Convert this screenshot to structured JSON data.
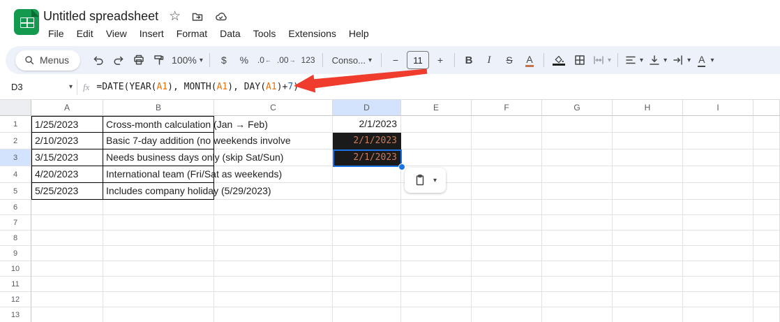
{
  "app": {
    "title": "Untitled spreadsheet",
    "menu_items": [
      "File",
      "Edit",
      "View",
      "Insert",
      "Format",
      "Data",
      "Tools",
      "Extensions",
      "Help"
    ]
  },
  "icons": {
    "star": "☆",
    "caret_down": "▾"
  },
  "toolbar": {
    "menus_label": "Menus",
    "zoom_level": "100%",
    "currency_label": "$",
    "percent_label": "%",
    "decrease_decimals_label": ".0",
    "decrease_decimals_arrow": "←",
    "increase_decimals_label": ".00",
    "increase_decimals_arrow": "→",
    "more_formats_label": "123",
    "font_name": "Conso...",
    "minus_label": "−",
    "font_size": "11",
    "plus_label": "+",
    "bold_label": "B",
    "italic_label": "I",
    "strikethrough_label": "S",
    "text_color_label": "A",
    "text_rotation_label": "A"
  },
  "formula_bar": {
    "cell_reference": "D3",
    "fx_label": "fx",
    "formula_full": "=DATE(YEAR(A1), MONTH(A1), DAY(A1)+7)",
    "formula_parts": [
      {
        "text": "=DATE(YEAR(",
        "type": "plain"
      },
      {
        "text": "A1",
        "type": "ref"
      },
      {
        "text": "), MONTH(",
        "type": "plain"
      },
      {
        "text": "A1",
        "type": "ref"
      },
      {
        "text": "), DAY(",
        "type": "plain"
      },
      {
        "text": "A1",
        "type": "ref"
      },
      {
        "text": ")+",
        "type": "plain"
      },
      {
        "text": "7",
        "type": "number"
      },
      {
        "text": ")",
        "type": "plain"
      }
    ]
  },
  "grid": {
    "column_headers": [
      "A",
      "B",
      "C",
      "D",
      "E",
      "F",
      "G",
      "H",
      "I",
      ""
    ],
    "row_headers": [
      "1",
      "2",
      "3",
      "4",
      "5",
      "6",
      "7",
      "8",
      "9",
      "10",
      "11",
      "12",
      "13"
    ],
    "selected_column": "D",
    "selected_row": 3,
    "active_cell": "D3",
    "cells": [
      {
        "ref": "A1",
        "text": "1/25/2023"
      },
      {
        "ref": "B1",
        "text": "Cross-month calculation (Jan → Feb)"
      },
      {
        "ref": "D1",
        "text": "2/1/2023",
        "align": "right"
      },
      {
        "ref": "A2",
        "text": "2/10/2023"
      },
      {
        "ref": "B2",
        "text": "Basic 7-day addition (no weekends involve"
      },
      {
        "ref": "D2",
        "text": "2/1/2023",
        "style": "dark",
        "align": "right"
      },
      {
        "ref": "A3",
        "text": "3/15/2023"
      },
      {
        "ref": "B3",
        "text": "Needs business days only (skip Sat/Sun)"
      },
      {
        "ref": "D3",
        "text": "2/1/2023",
        "style": "dark",
        "align": "right"
      },
      {
        "ref": "A4",
        "text": "4/20/2023"
      },
      {
        "ref": "B4",
        "text": "International team (Fri/Sat as weekends)"
      },
      {
        "ref": "A5",
        "text": "5/25/2023"
      },
      {
        "ref": "B5",
        "text": "Includes company holiday (5/29/2023)"
      }
    ]
  },
  "colors": {
    "selection_blue": "#1a73e8",
    "header_highlight": "#d3e3fd",
    "dark_cell_bg": "#1a1a1a",
    "dark_cell_text": "#cd7b54",
    "formula_ref_orange": "#e8710a",
    "formula_number_blue": "#1967d2",
    "annotation_arrow_red": "#f03c2d",
    "brand_green": "#149a4e",
    "icon_gray": "#444746",
    "text_color_underline": "#c5734f",
    "fill_color_underline": "#1f1f1f"
  }
}
